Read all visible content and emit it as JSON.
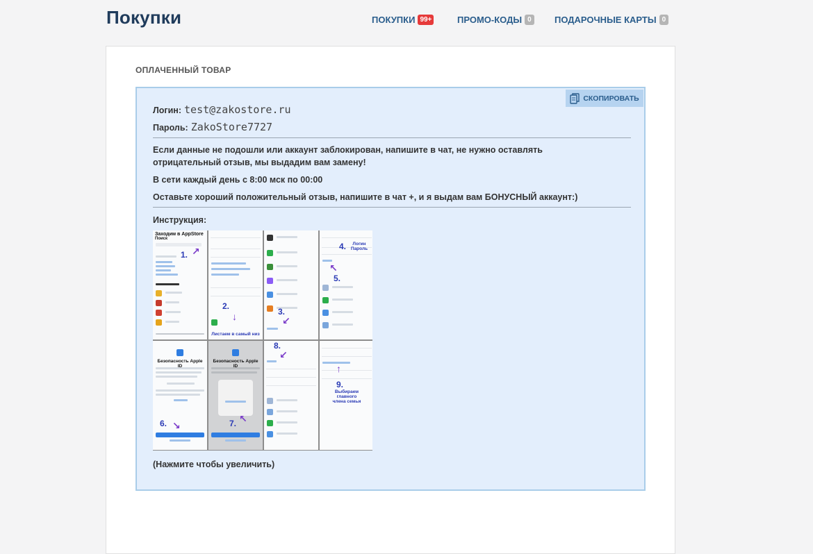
{
  "page": {
    "title": "Покупки"
  },
  "nav": [
    {
      "label": "ПОКУПКИ",
      "badge": "99+",
      "badge_color": "#e63a3a"
    },
    {
      "label": "ПРОМО-КОДЫ",
      "badge": "0",
      "badge_color": "#b5b5b5"
    },
    {
      "label": "ПОДАРОЧНЫЕ КАРТЫ",
      "badge": "0",
      "badge_color": "#b5b5b5"
    }
  ],
  "order": {
    "section_title": "ОПЛАЧЕННЫЙ ТОВАР",
    "copy_label": "СКОПИРОВАТЬ",
    "copy_icon": "copy-icon",
    "login_label": "Логин:",
    "login_value": "test@zakostore.ru",
    "password_label": "Пароль:",
    "password_value": "ZakoStore7727",
    "notice": "Если данные не подошли или аккаунт заблокирован, напишите в чат, не нужно оставлять отрицательный отзыв, мы выдадим вам замену!",
    "online_hours": "В сети каждый день с 8:00 мск по 00:00",
    "review_note": "Оставьте хороший положительный отзыв, напишите в чат +, и я выдам вам БОНУСНЫЙ аккаунт:)",
    "instruction_label": "Инструкция:",
    "instruction_caption": "(Нажмите чтобы увеличить)"
  },
  "instruction_image": {
    "panel1_title": "Заходим в AppStore",
    "panel1_subtitle": "Поиск",
    "panel2_caption": "Листаем в самый низ",
    "panel4_caption": "Логин Пароль",
    "panel5_title": "Безопасность Apple ID",
    "panel6_title": "Безопасность Apple ID",
    "panel8_caption": "Выбираем главного члена семьи",
    "steps": [
      "1.",
      "2.",
      "3.",
      "4.",
      "5.",
      "6.",
      "7.",
      "8.",
      "9."
    ]
  },
  "colors": {
    "title": "#1f3b5b",
    "nav_link": "#2a5d8c",
    "box_bg": "#e3eefc",
    "box_border": "#a9cde9",
    "copy_btn_bg": "#b6d3f0"
  }
}
